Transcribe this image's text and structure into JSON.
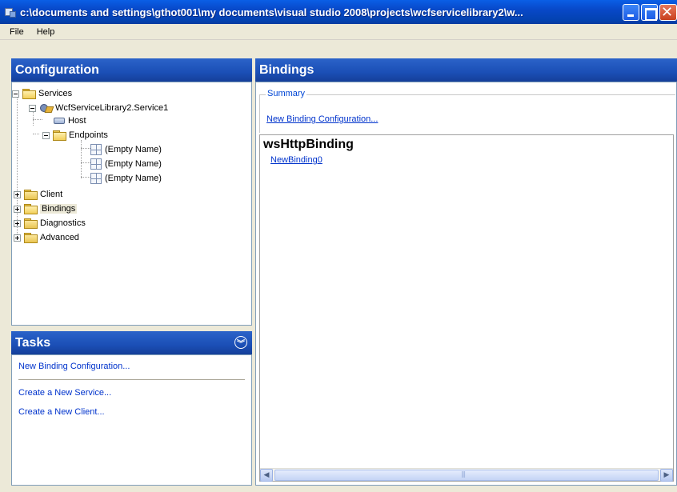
{
  "window": {
    "title": "c:\\documents and settings\\gthot001\\my documents\\visual studio 2008\\projects\\wcfservicelibrary2\\w..."
  },
  "menu": {
    "file": "File",
    "help": "Help"
  },
  "configuration": {
    "header": "Configuration",
    "tree": {
      "services": "Services",
      "service1": "WcfServiceLibrary2.Service1",
      "host": "Host",
      "endpoints": "Endpoints",
      "endpoint_items": [
        "(Empty Name)",
        "(Empty Name)",
        "(Empty Name)"
      ],
      "client": "Client",
      "bindings": "Bindings",
      "diagnostics": "Diagnostics",
      "advanced": "Advanced"
    }
  },
  "tasks": {
    "header": "Tasks",
    "items": [
      "New Binding Configuration...",
      "Create a New Service...",
      "Create a New Client..."
    ]
  },
  "bindings": {
    "header": "Bindings",
    "summary_legend": "Summary",
    "new_binding_link": "New Binding Configuration...",
    "binding_type": "wsHttpBinding",
    "binding_item": "NewBinding0"
  }
}
